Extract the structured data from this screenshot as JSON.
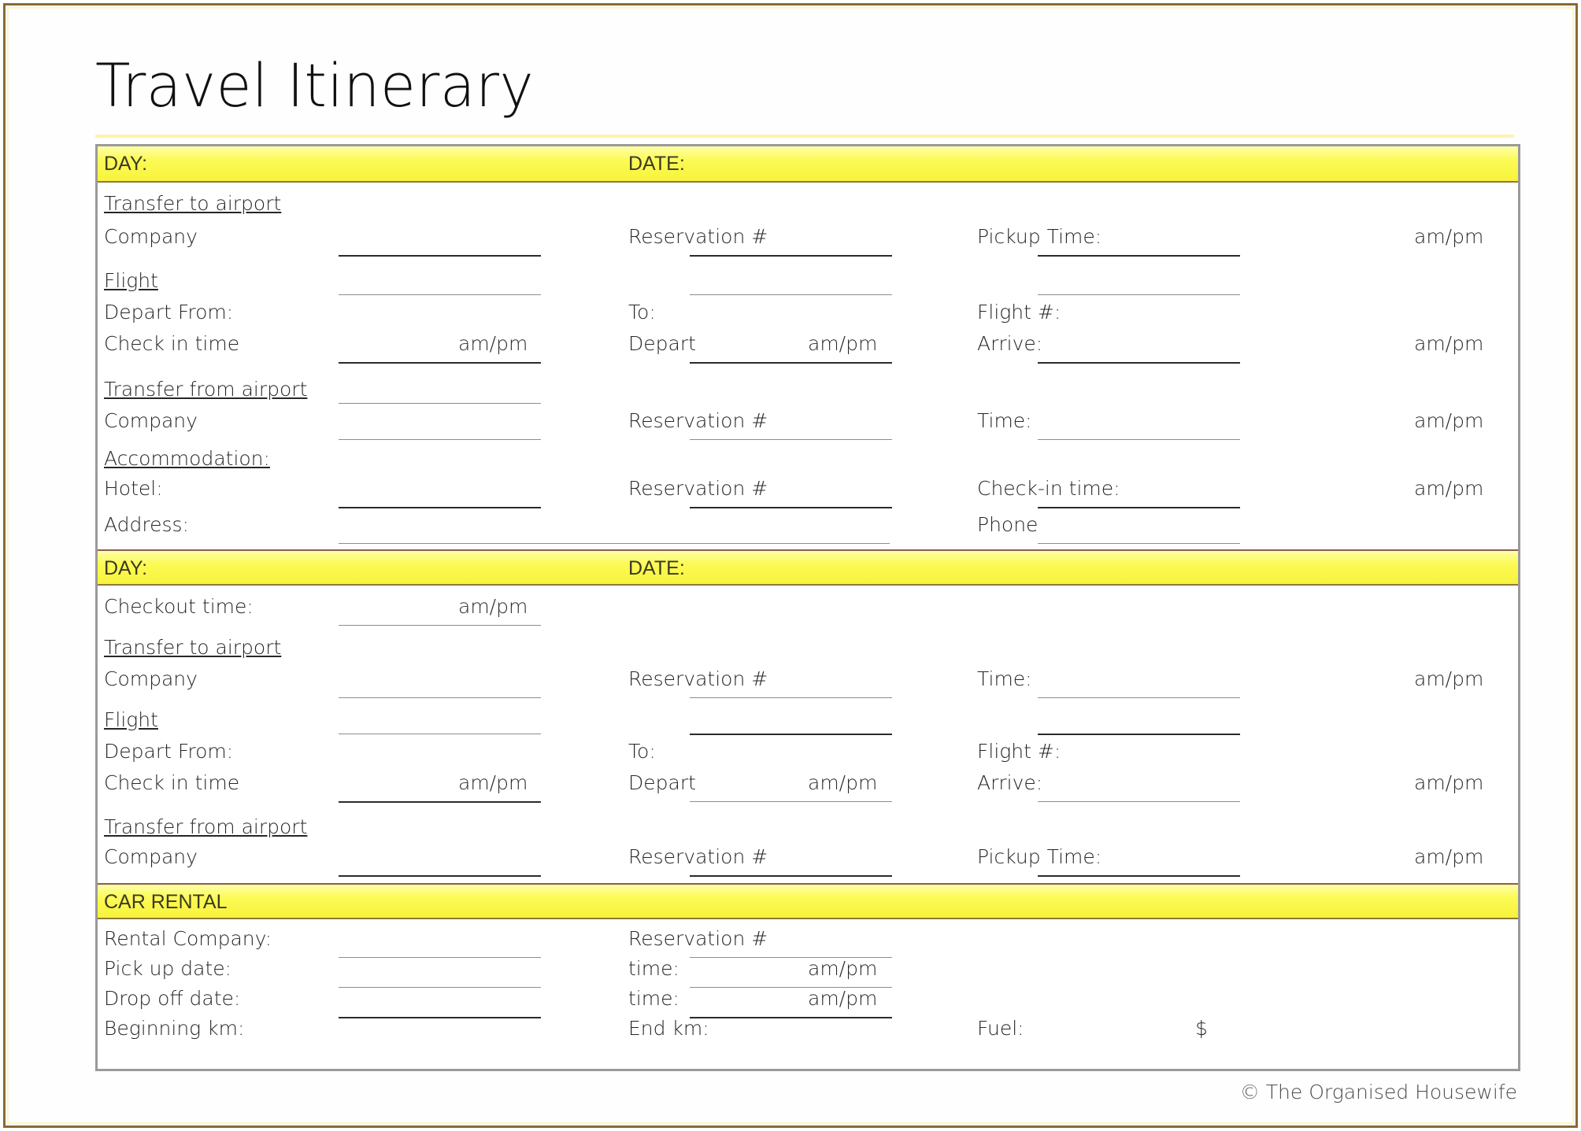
{
  "document": {
    "title": "Travel Itinerary",
    "credit": "© The Organised Housewife"
  },
  "common": {
    "ampm": "am/pm",
    "reservation_label": "Reservation #",
    "company_label": "Company",
    "day_label": "DAY:",
    "date_label": "DATE:"
  },
  "sections": [
    {
      "id": "day-one",
      "header": {
        "day": "DAY:",
        "date": "DATE:"
      },
      "groups": [
        {
          "id": "transfer-to-airport",
          "heading": "Transfer to airport",
          "rows": [
            {
              "col1": "Company",
              "col2": "Reservation #",
              "col3": "Pickup Time:",
              "col3_ampm": "am/pm"
            }
          ]
        },
        {
          "id": "flight",
          "heading": "Flight",
          "rows": [
            {
              "col1": "Depart From:",
              "col2": "To:",
              "col3": "Flight #:"
            },
            {
              "col1": "Check in time",
              "col1_ampm": "am/pm",
              "col2": "Depart",
              "col2_ampm": "am/pm",
              "col3": "Arrive:",
              "col3_ampm": "am/pm"
            }
          ]
        },
        {
          "id": "transfer-from-airport",
          "heading": "Transfer from airport",
          "rows": [
            {
              "col1": "Company",
              "col2": "Reservation #",
              "col3": "Time:",
              "col3_ampm": "am/pm"
            }
          ]
        },
        {
          "id": "accommodation",
          "heading": "Accommodation:",
          "rows": [
            {
              "col1": "Hotel:",
              "col2": "Reservation #",
              "col3": "Check-in time:",
              "col3_ampm": "am/pm"
            },
            {
              "col1": "Address:",
              "col2": "",
              "col3": "Phone"
            }
          ]
        }
      ]
    },
    {
      "id": "day-two",
      "header": {
        "day": "DAY:",
        "date": "DATE:"
      },
      "groups": [
        {
          "id": "checkout",
          "heading": "",
          "rows": [
            {
              "col1": "Checkout time:",
              "col1_ampm": "am/pm"
            }
          ]
        },
        {
          "id": "transfer-to-airport-2",
          "heading": "Transfer to airport",
          "rows": [
            {
              "col1": "Company",
              "col2": "Reservation #",
              "col3": "Time:",
              "col3_ampm": "am/pm"
            }
          ]
        },
        {
          "id": "flight-2",
          "heading": "Flight",
          "rows": [
            {
              "col1": "Depart From:",
              "col2": "To:",
              "col3": "Flight #:"
            },
            {
              "col1": "Check in time",
              "col1_ampm": "am/pm",
              "col2": "Depart",
              "col2_ampm": "am/pm",
              "col3": "Arrive:",
              "col3_ampm": "am/pm"
            }
          ]
        },
        {
          "id": "transfer-from-airport-2",
          "heading": "Transfer from airport",
          "rows": [
            {
              "col1": "Company",
              "col2": "Reservation #",
              "col3": "Pickup Time:",
              "col3_ampm": "am/pm"
            }
          ]
        }
      ]
    },
    {
      "id": "car-rental",
      "header": {
        "day": "CAR RENTAL",
        "date": ""
      },
      "groups": [
        {
          "id": "car-rental-fields",
          "heading": "",
          "rows": [
            {
              "col1": "Rental Company:",
              "col2": "Reservation #"
            },
            {
              "col1": "Pick up date:",
              "col2": "time:",
              "col2_ampm": "am/pm"
            },
            {
              "col1": "Drop off date:",
              "col2": "time:",
              "col2_ampm": "am/pm"
            },
            {
              "col1": "Beginning km:",
              "col2": "End km:",
              "col3": "Fuel:",
              "col3_money": "$"
            }
          ]
        }
      ]
    }
  ]
}
